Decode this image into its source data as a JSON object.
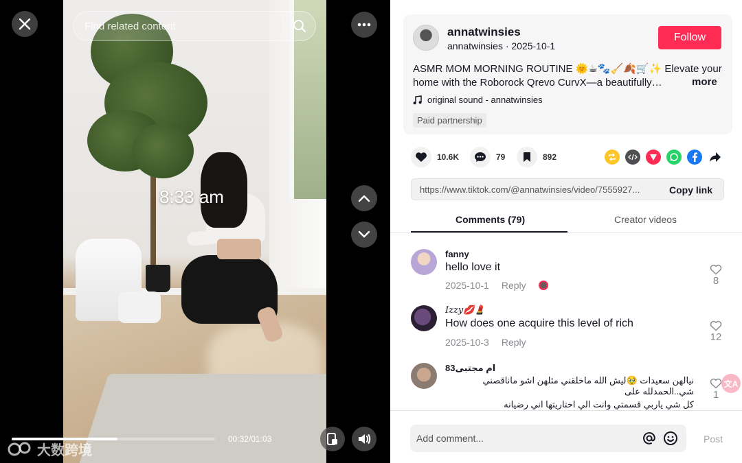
{
  "video": {
    "search_placeholder": "Find related content",
    "overlay_time": "8:33 am",
    "progress_fraction": 0.52,
    "time_label": "00:32/01:03",
    "watermark": "大数跨境"
  },
  "post": {
    "author_name": "annatwinsies",
    "author_meta": "annatwinsies · 2025-10-1",
    "follow_label": "Follow",
    "caption": "ASMR MOM MORNING ROUTINE 🌞☕🐾🧹🍂🛒✨ Elevate your home with the Roborock Qrevo CurvX—a beautifully…",
    "more_label": "more",
    "sound": "original sound - annatwinsies",
    "paid_label": "Paid partnership"
  },
  "actions": {
    "likes": "10.6K",
    "comments": "79",
    "saves": "892"
  },
  "share": {
    "link": "https://www.tiktok.com/@annatwinsies/video/7555927...",
    "copy_label": "Copy link"
  },
  "tabs": {
    "comments_label": "Comments (79)",
    "creator_label": "Creator videos"
  },
  "comments": [
    {
      "user": "fanny",
      "text": "hello love it",
      "date": "2025-10-1",
      "reply": "Reply",
      "likes": "8"
    },
    {
      "user": "Izzy💋💄",
      "text": "How does one acquire this level of rich",
      "date": "2025-10-3",
      "reply": "Reply",
      "likes": "12"
    },
    {
      "user": "ام مجتبى83",
      "text_line1": "نيالهن سعيدات 🥹ليش الله ماخلقني مثلهن اشو ماناقصني شي..الحمدلله على",
      "text_line2": "كل شي ياربي قسمتي وانت الي اختاريتها اني رضيانه",
      "likes": "1"
    }
  ],
  "composer": {
    "placeholder": "Add comment...",
    "post_label": "Post",
    "translate_label": "文A"
  },
  "colors": {
    "follow": "#fe2c55",
    "text": "#161823",
    "muted": "#8a8b91"
  }
}
